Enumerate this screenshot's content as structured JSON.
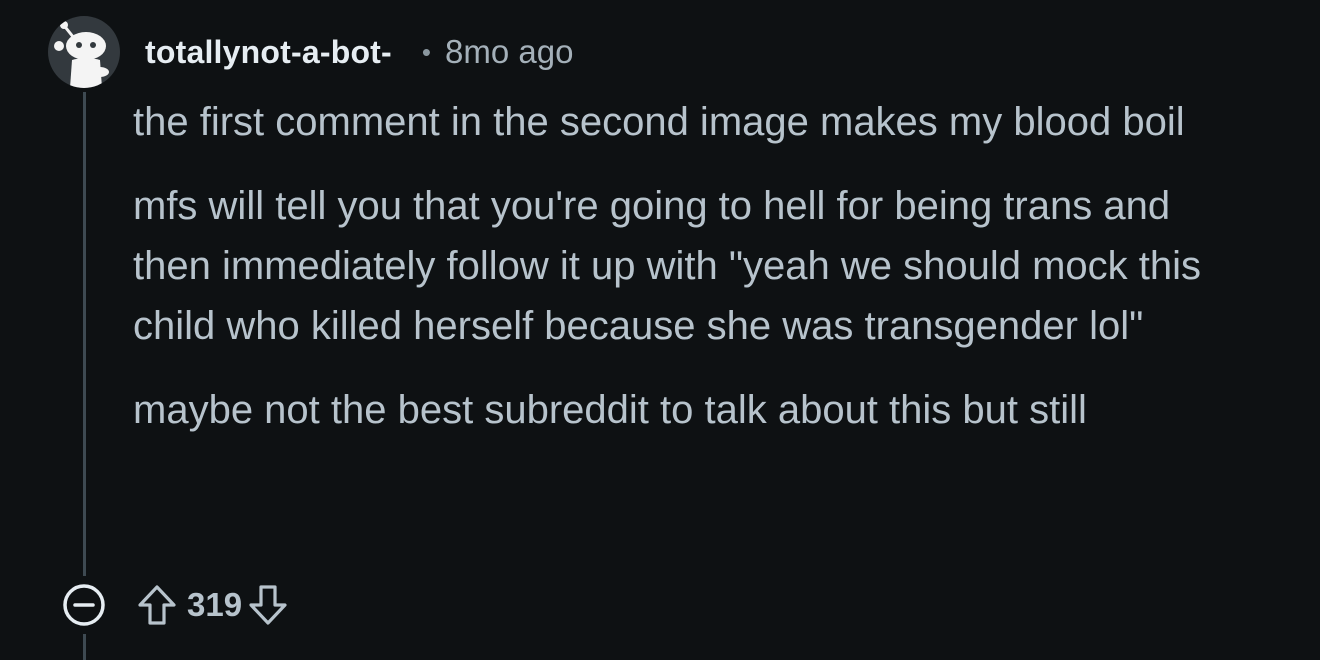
{
  "comment": {
    "username": "totallynot-a-bot-",
    "separator": "•",
    "timestamp": "8mo ago",
    "paragraphs": [
      "the first comment in the second image makes my blood boil",
      "mfs will tell you that you're going to hell for being trans and then immediately follow it up with \"yeah we should mock this child who killed herself because she was transgender lol\"",
      "maybe not the best subreddit to talk about this but still"
    ],
    "score": "319"
  },
  "icons": {
    "avatar": "snoo-avatar-icon",
    "collapse": "collapse-minus-icon",
    "upvote": "upvote-arrow-icon",
    "downvote": "downvote-arrow-icon"
  },
  "colors": {
    "background": "#0e1113",
    "username": "#e6edf2",
    "text": "#b7c3cc",
    "thread_line": "#3e4a52"
  }
}
